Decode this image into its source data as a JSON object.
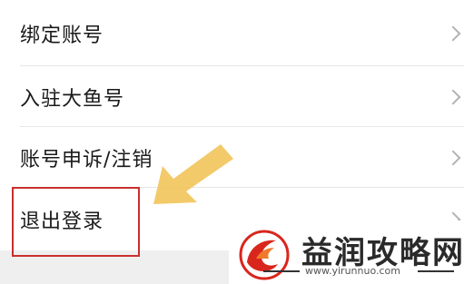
{
  "settings": {
    "items": [
      {
        "label": "绑定账号"
      },
      {
        "label": "入驻大鱼号"
      },
      {
        "label": "账号申诉/注销"
      },
      {
        "label": "退出登录"
      }
    ]
  },
  "watermark": {
    "title": "益润攻略网",
    "url": "www.yirunnuo.com"
  },
  "colors": {
    "highlight": "#c8302e",
    "arrow": "#f2c45a",
    "logo_red": "#d9261c"
  },
  "icons": {
    "chevron": "chevron-right-icon",
    "arrow": "pointer-arrow-icon",
    "logo": "flame-logo-icon"
  }
}
